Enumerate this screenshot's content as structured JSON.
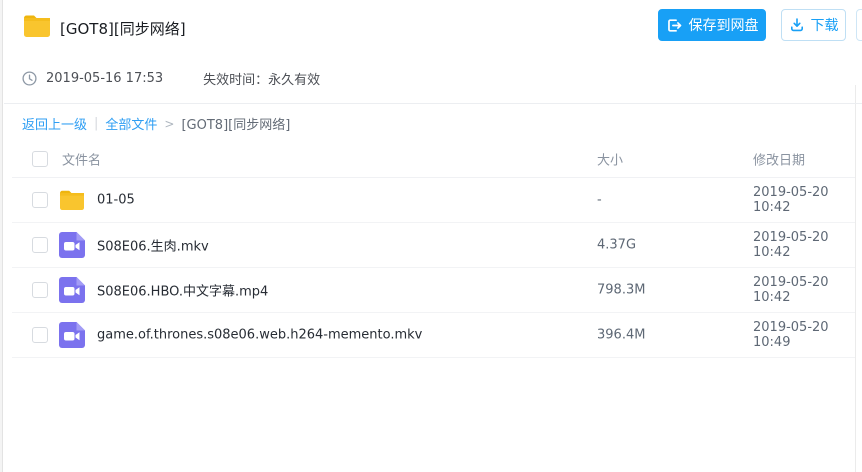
{
  "page": {
    "title": "[GOT8][同步网络]",
    "share_time": "2019-05-16 17:53",
    "expiry": "失效时间：永久有效"
  },
  "actions": {
    "save_label": "保存到网盘",
    "download_label": "下载"
  },
  "breadcrumb": {
    "back": "返回上一级",
    "separator": "|",
    "all_files": "全部文件",
    "arrow": ">",
    "current": "[GOT8][同步网络]"
  },
  "table": {
    "headers": {
      "name": "文件名",
      "size": "大小",
      "modified": "修改日期"
    },
    "rows": [
      {
        "type": "folder",
        "name": "01-05",
        "size": "-",
        "modified": "2019-05-20 10:42"
      },
      {
        "type": "video",
        "name": "S08E06.生肉.mkv",
        "size": "4.37G",
        "modified": "2019-05-20 10:42"
      },
      {
        "type": "video",
        "name": "S08E06.HBO.中文字幕.mp4",
        "size": "798.3M",
        "modified": "2019-05-20 10:42"
      },
      {
        "type": "video",
        "name": "game.of.thrones.s08e06.web.h264-memento.mkv",
        "size": "396.4M",
        "modified": "2019-05-20 10:49"
      }
    ]
  },
  "icons": {
    "folder": "folder-icon",
    "video": "video-file-icon",
    "clock": "clock-icon",
    "save": "save-to-disk-icon",
    "download": "download-icon"
  },
  "colors": {
    "accent_blue": "#18a0f6",
    "video_purple": "#7b72ee",
    "folder_yellow": "#f9c52e",
    "text_dark": "#272c34",
    "text_gray": "#8a93a0"
  }
}
